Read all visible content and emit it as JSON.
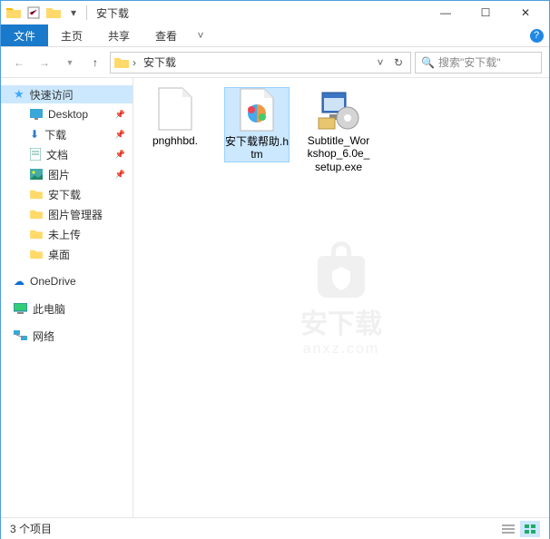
{
  "window": {
    "title": "安下载",
    "minimize": "—",
    "maximize": "☐",
    "close": "✕"
  },
  "ribbon": {
    "file": "文件",
    "home": "主页",
    "share": "共享",
    "view": "查看"
  },
  "breadcrumb": {
    "chevron": "›",
    "current": "安下载"
  },
  "search": {
    "placeholder": "搜索\"安下载\""
  },
  "sidebar": {
    "quick": "快速访问",
    "items": [
      {
        "label": "Desktop",
        "pinned": true
      },
      {
        "label": "下载",
        "pinned": true
      },
      {
        "label": "文档",
        "pinned": true
      },
      {
        "label": "图片",
        "pinned": true
      },
      {
        "label": "安下载",
        "pinned": false
      },
      {
        "label": "图片管理器",
        "pinned": false
      },
      {
        "label": "未上传",
        "pinned": false
      },
      {
        "label": "桌面",
        "pinned": false
      }
    ],
    "onedrive": "OneDrive",
    "thispc": "此电脑",
    "network": "网络"
  },
  "files": [
    {
      "name": "pnghhbd.",
      "type": "blank"
    },
    {
      "name": "安下载帮助.htm",
      "type": "htm",
      "selected": true
    },
    {
      "name": "Subtitle_Workshop_6.0e_setup.exe",
      "type": "exe"
    }
  ],
  "watermark": {
    "text": "安下载",
    "sub": "anxz.com"
  },
  "statusbar": {
    "count": "3 个项目"
  }
}
